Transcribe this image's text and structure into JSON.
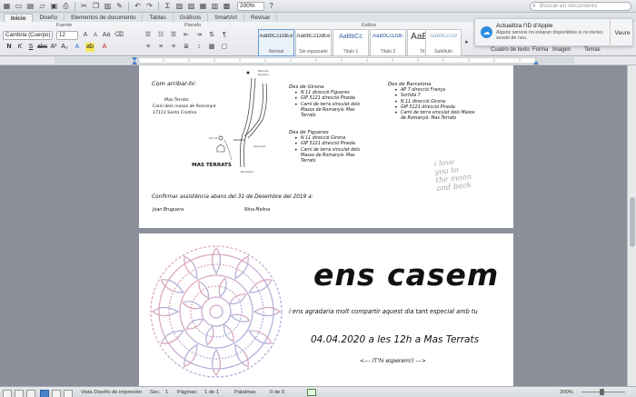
{
  "toolbar": {
    "zoom": "200%",
    "search_placeholder": "Buscar en documento"
  },
  "tabs": [
    "Inicio",
    "Diseño",
    "Elementos de documento",
    "Tablas",
    "Gráficos",
    "SmartArt",
    "Revisar"
  ],
  "ribbon": {
    "font_group": "Fuente",
    "paragraph_group": "Párrafo",
    "styles_group": "Estilos",
    "font": "Cambria (Cuerpo)",
    "size": "12",
    "styles": [
      {
        "sample": "AaBbCcDdEe",
        "name": "Normal"
      },
      {
        "sample": "AaBbCcDdEe",
        "name": "Sin espaciado"
      },
      {
        "sample": "AaBbCc",
        "name": "Título 1"
      },
      {
        "sample": "AaBbCcDdE",
        "name": "Título 2"
      },
      {
        "sample": "AaBbC",
        "name": "Título"
      },
      {
        "sample": "AaBbCcDd",
        "name": "Subtítulo"
      }
    ],
    "right_tools": [
      "Cuadro de texto",
      "Forma",
      "Imagen",
      "Temas"
    ]
  },
  "notification": {
    "title": "Actualitza l'ID d'Apple",
    "body": "Alguns serveis no estaran disponibles si no inicies sessió de nou.",
    "action": "Veure"
  },
  "page1": {
    "map_heading": "Com arribar-hi:",
    "directions_left": [
      "Mas Terrats",
      "Camí dels masos de Romanyà",
      "17113 Santa Cristina"
    ],
    "map_label": "MAS TERRATS",
    "map_tiny": [
      "Palamós",
      "Figueres",
      "Barcelona",
      "Girona",
      "Romanyà"
    ],
    "girona": {
      "title": "Des de Girona",
      "items": [
        "N 11 direcció Figueres",
        "GIP 5121 direcció Pineda",
        "Camí de terra vinculat dels Masos de Romanyà: Mas Terrats"
      ]
    },
    "figueres": {
      "title": "Des de Figueres",
      "items": [
        "N 11 direcció Girona",
        "GIP 5121 direcció Pineda",
        "Camí de terra vinculat dels Masos de Romanyà: Mas Terrats"
      ]
    },
    "barcelona": {
      "title": "Des de Barcelona",
      "items": [
        "AP 7 direcció França",
        "Sortida 7",
        "N 11 direcció Girona",
        "GIP 5121 direcció Pineda",
        "Camí de terra vinculat dels Masos de Romanyà: Mas Terrats"
      ]
    },
    "love_text": [
      "i love",
      "you to",
      "the moon",
      "and back"
    ],
    "confirm": "Confirmar assistència abans del 31 de Desembre del 2019 a:",
    "name1": "Joan Bruguera",
    "name2": "Nina Molina"
  },
  "page2": {
    "title": "ens casem",
    "line1": "i ens agradaria molt compartir aquest dia tant especial amb tu",
    "date": "04.04.2020 a les 12h a Mas Terrats",
    "closing": "T'hi esperem!"
  },
  "status": {
    "view": "Vista Diseño de impresión",
    "sec_label": "Sec.",
    "sec": "1",
    "pages_label": "Páginas:",
    "pages": "1 de 1",
    "words_label": "Palabras:",
    "words": "0 de 0",
    "zoom": "200%"
  }
}
